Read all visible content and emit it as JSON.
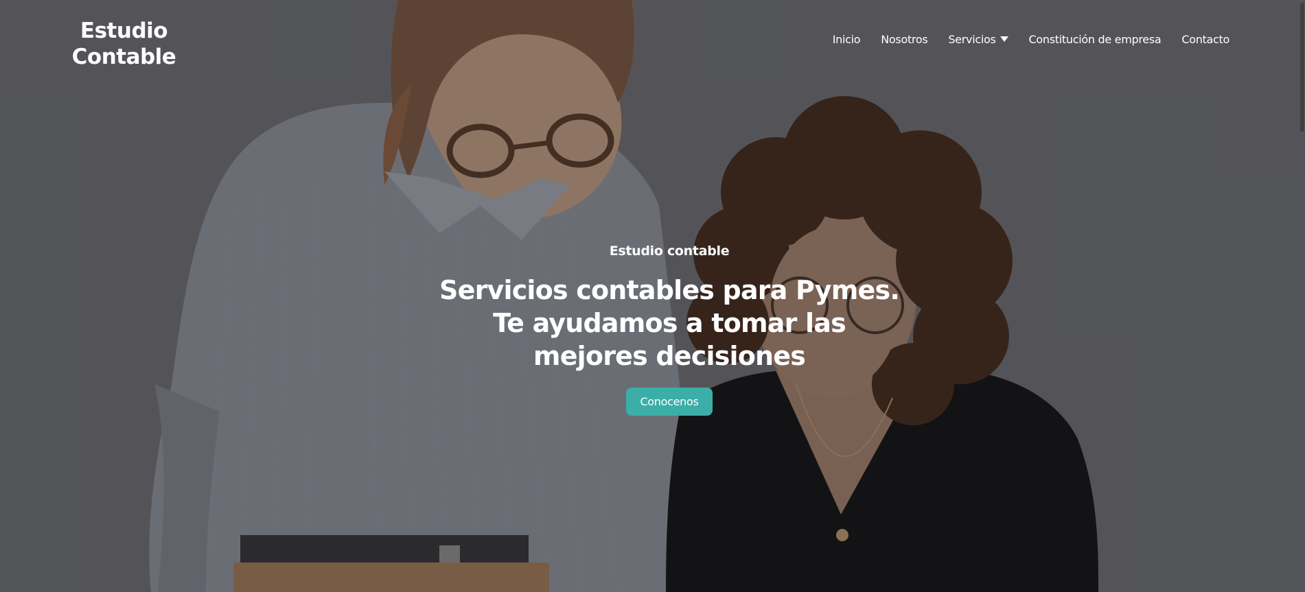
{
  "header": {
    "logo_line1": "Estudio",
    "logo_line2": "Contable",
    "nav": [
      {
        "label": "Inicio",
        "has_dropdown": false
      },
      {
        "label": "Nosotros",
        "has_dropdown": false
      },
      {
        "label": "Servicios",
        "has_dropdown": true,
        "icon": "caret-down-icon"
      },
      {
        "label": "Constitución de empresa",
        "has_dropdown": false
      },
      {
        "label": "Contacto",
        "has_dropdown": false
      }
    ]
  },
  "hero": {
    "eyebrow": "Estudio contable",
    "headline": "Servicios contables para Pymes. Te ayudamos a tomar las mejores decisiones",
    "cta_label": "Conocenos"
  },
  "colors": {
    "accent": "#3aaea7",
    "text": "#ffffff",
    "overlay": "#5c5d60"
  }
}
